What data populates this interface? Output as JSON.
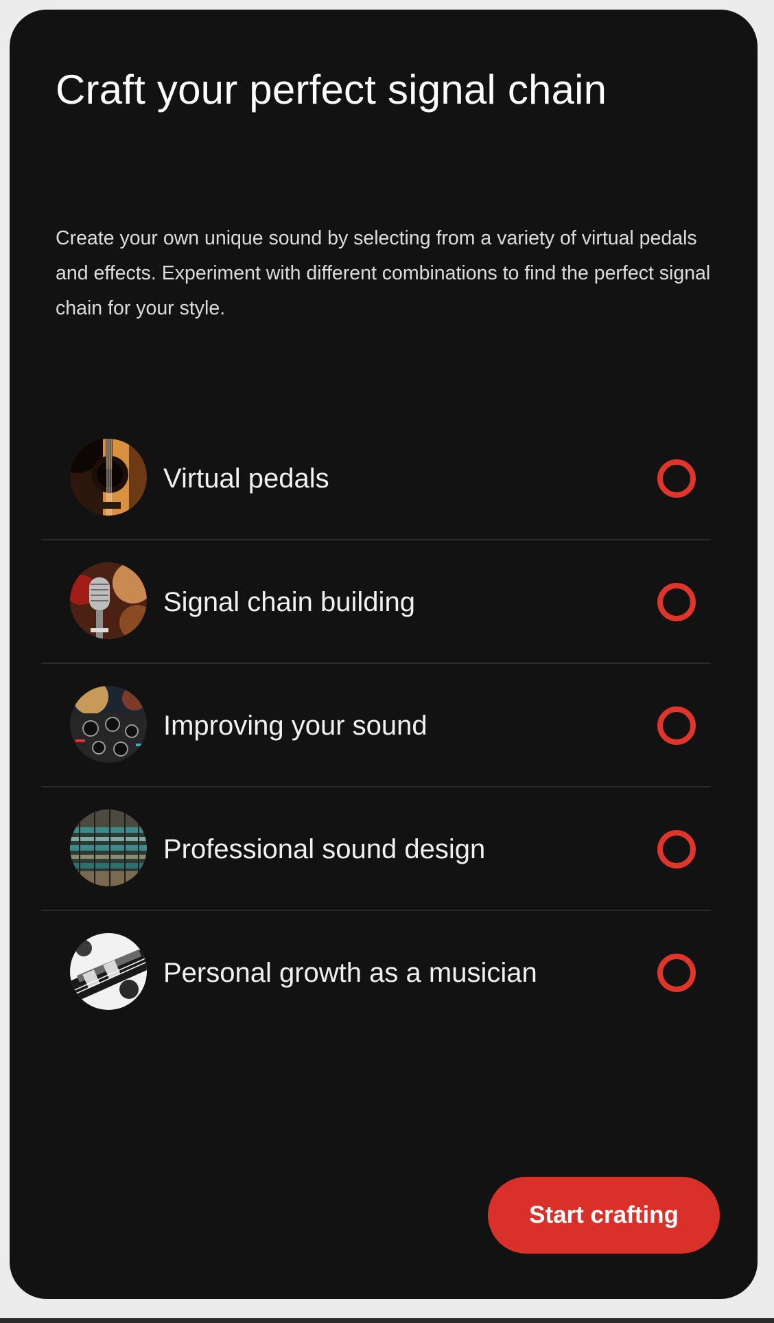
{
  "header": {
    "title": "Craft your perfect signal chain"
  },
  "intro": {
    "description": "Create your own unique sound by selecting from a variety of virtual pedals and effects. Experiment with different combinations to find the perfect signal chain for your style."
  },
  "options": [
    {
      "label": "Virtual pedals",
      "image": "acoustic-guitar-thumbnail",
      "selected": false
    },
    {
      "label": "Signal chain building",
      "image": "microphone-thumbnail",
      "selected": false
    },
    {
      "label": "Improving your sound",
      "image": "mixing-console-knobs-thumbnail",
      "selected": false
    },
    {
      "label": "Professional sound design",
      "image": "circuit-board-thumbnail",
      "selected": false
    },
    {
      "label": "Personal growth as a musician",
      "image": "electric-guitar-thumbnail",
      "selected": false
    }
  ],
  "actions": {
    "start_label": "Start crafting"
  },
  "colors": {
    "background": "#121212",
    "accent": "#d9302a",
    "radio_ring": "#e0352a"
  }
}
